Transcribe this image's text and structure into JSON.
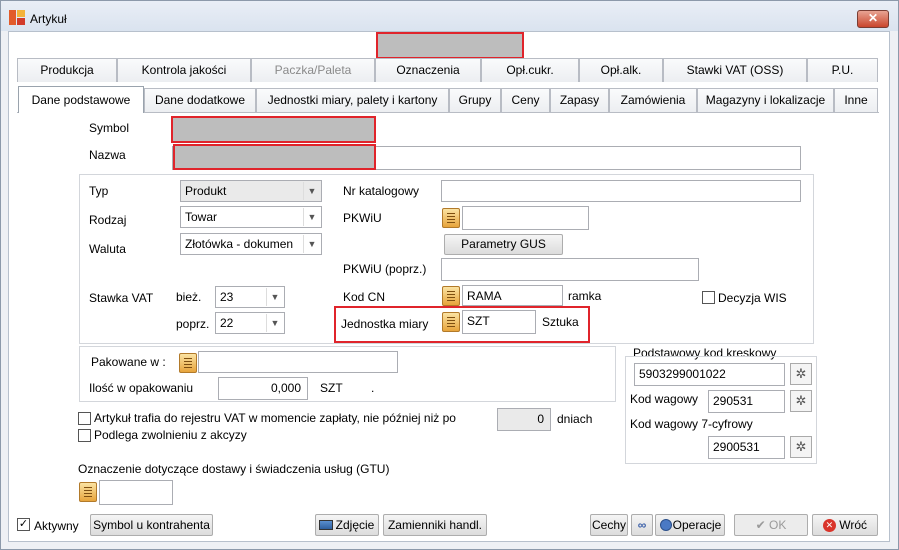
{
  "window": {
    "title": "Artykuł",
    "close_label": "✕"
  },
  "tabs_row1": [
    "Produkcja",
    "Kontrola jakości",
    "Paczka/Paleta",
    "Oznaczenia",
    "Opł.cukr.",
    "Opł.alk.",
    "Stawki VAT (OSS)",
    "P.U."
  ],
  "tabs_row2": [
    "Dane podstawowe",
    "Dane dodatkowe",
    "Jednostki miary, palety i kartony",
    "Grupy",
    "Ceny",
    "Zapasy",
    "Zamówienia",
    "Magazyny i lokalizacje",
    "Inne"
  ],
  "form": {
    "symbol_label": "Symbol",
    "nazwa_label": "Nazwa",
    "typ_label": "Typ",
    "typ_value": "Produkt",
    "rodzaj_label": "Rodzaj",
    "rodzaj_value": "Towar",
    "waluta_label": "Waluta",
    "waluta_value": "Złotówka - dokumen",
    "stawka_label": "Stawka VAT",
    "biez_label": "bież.",
    "biez_value": "23",
    "poprz_label": "poprz.",
    "poprz_value": "22",
    "nr_katalogowy_label": "Nr katalogowy",
    "pkwiu_label": "PKWiU",
    "parametry_gus_label": "Parametry GUS",
    "pkwiu_poprz_label": "PKWiU (poprz.)",
    "kod_cn_label": "Kod CN",
    "kod_cn_value": "RAMA",
    "kod_cn_desc": "ramka",
    "decyzja_label": "Decyzja WIS",
    "jm_label": "Jednostka miary",
    "jm_value": "SZT",
    "jm_desc": "Sztuka",
    "pakowane_label": "Pakowane w :",
    "ilosc_label": "Ilość w opakowaniu",
    "ilosc_value": "0,000",
    "ilosc_unit": "SZT",
    "ilosc_dot": ".",
    "kody_header": "Podstawowy kod kreskowy",
    "kod_kreskowy_value": "5903299001022",
    "kod_wagowy_label": "Kod wagowy",
    "kod_wagowy_value": "290531",
    "kod_wagowy7_label": "Kod wagowy 7-cyfrowy",
    "kod_wagowy7_value": "2900531",
    "vat_rejestr_label": "Artykuł trafia do rejestru VAT w momencie zapłaty, nie później niż po",
    "vat_days_value": "0",
    "vat_days_unit": "dniach",
    "akcyza_label": "Podlega zwolnieniu z akcyzy",
    "gtu_label": "Oznaczenie dotyczące dostawy i świadczenia usług (GTU)"
  },
  "footer": {
    "aktywny_label": "Aktywny",
    "aktywny_check": "✓",
    "symbol_kontrahenta": "Symbol u kontrahenta",
    "zdjecie": "Zdjęcie",
    "zamienniki": "Zamienniki handl.",
    "cechy": "Cechy",
    "operacje": "Operacje",
    "ok": "OK",
    "wroc": "Wróć"
  }
}
